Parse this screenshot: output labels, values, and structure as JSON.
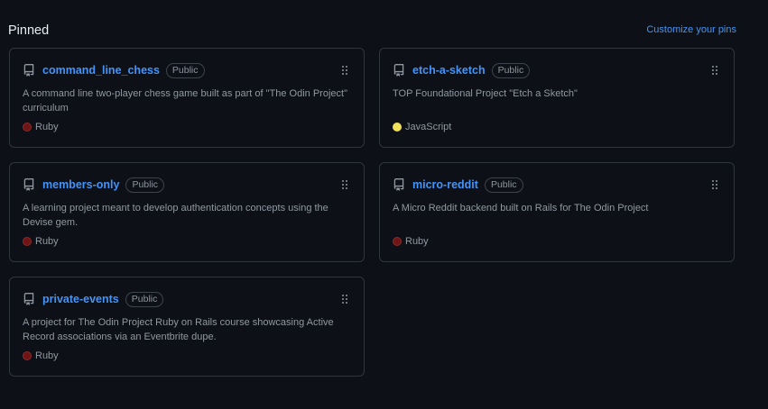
{
  "header": {
    "title": "Pinned",
    "customize_label": "Customize your pins"
  },
  "colors": {
    "background": "#0d1117",
    "border": "#30363d",
    "link": "#4493f8",
    "muted": "#9198a1",
    "ruby": "#701516",
    "javascript": "#f1e05a"
  },
  "cards": [
    {
      "name": "command_line_chess",
      "badge": "Public",
      "description": "A command line two-player chess game built as part of \"The Odin Project\" curriculum",
      "language": "Ruby",
      "language_color": "#701516",
      "icon": "repo-icon"
    },
    {
      "name": "etch-a-sketch",
      "badge": "Public",
      "description": "TOP Foundational Project \"Etch a Sketch\"",
      "language": "JavaScript",
      "language_color": "#f1e05a",
      "icon": "repo-icon"
    },
    {
      "name": "members-only",
      "badge": "Public",
      "description": "A learning project meant to develop authentication concepts using the Devise gem.",
      "language": "Ruby",
      "language_color": "#701516",
      "icon": "repo-icon"
    },
    {
      "name": "micro-reddit",
      "badge": "Public",
      "description": "A Micro Reddit backend built on Rails for The Odin Project",
      "language": "Ruby",
      "language_color": "#701516",
      "icon": "repo-icon"
    },
    {
      "name": "private-events",
      "badge": "Public",
      "description": "A project for The Odin Project Ruby on Rails course showcasing Active Record associations via an Eventbrite dupe.",
      "language": "Ruby",
      "language_color": "#701516",
      "icon": "repo-icon"
    }
  ]
}
